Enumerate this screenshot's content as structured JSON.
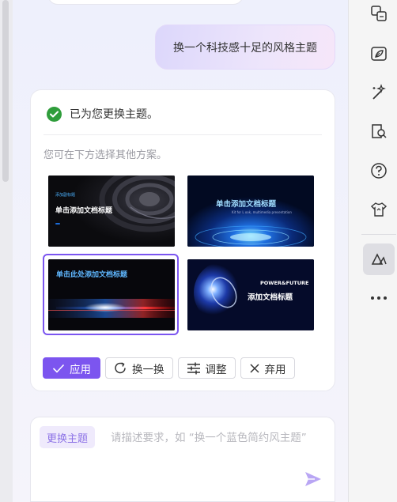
{
  "conversation": {
    "user_message": "换一个科技感十足的风格主题",
    "reply": {
      "status_text": "已为您更换主题。",
      "hint_text": "您可在下方选择其他方案。",
      "themes": [
        {
          "title": "单击添加文档标题",
          "kicker": "添加副标题",
          "selected": false
        },
        {
          "title": "单击添加文档标题",
          "subtitle": "Kit for L ook, multimedia presentation",
          "selected": false
        },
        {
          "title": "单击此处添加文档标题",
          "selected": true
        },
        {
          "title_line1": "POWER&FUTURE",
          "title_line2": "添加文档标题",
          "selected": false
        }
      ],
      "actions": {
        "apply": "应用",
        "shuffle": "换一换",
        "adjust": "调整",
        "discard": "弃用"
      }
    }
  },
  "input": {
    "mode_tag": "更换主题",
    "placeholder": "请描述要求，如 “换一个蓝色简约风主题”"
  },
  "toolbar": {
    "icons": [
      "translate-icon",
      "leaf-image-icon",
      "magic-wand-icon",
      "book-search-icon",
      "help-icon",
      "tshirt-icon",
      "theme-icon",
      "more-icon"
    ],
    "active": "theme-icon"
  },
  "colors": {
    "accent": "#7c55ef",
    "success": "#2f9d3b"
  }
}
